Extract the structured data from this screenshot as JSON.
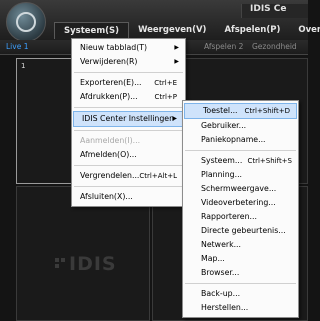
{
  "app": {
    "title": "IDIS Ce"
  },
  "menubar": {
    "items": [
      "Systeem(S)",
      "Weergeven(V)",
      "Afspelen(P)",
      "Over(A)"
    ]
  },
  "tabs": [
    "Live 1",
    "Afspelen 2",
    "Gezondheid"
  ],
  "grid": {
    "cell1_number": "1",
    "watermark": "IDIS"
  },
  "system_menu": {
    "items": [
      {
        "label": "Nieuw tabblad(T)",
        "submenu": true
      },
      {
        "label": "Verwijderen(R)",
        "submenu": true
      },
      {
        "label": "Exporteren(E)...",
        "shortcut": "Ctrl+E"
      },
      {
        "label": "Afdrukken(P)...",
        "shortcut": "Ctrl+P"
      },
      {
        "label": "IDIS Center Instellingen",
        "submenu": true
      },
      {
        "label": "Aanmelden(I)...",
        "disabled": true
      },
      {
        "label": "Afmelden(O)..."
      },
      {
        "label": "Vergrendelen...",
        "shortcut": "Ctrl+Alt+L"
      },
      {
        "label": "Afsluiten(X)..."
      }
    ]
  },
  "settings_submenu": {
    "items": [
      {
        "label": "Toestel...",
        "shortcut": "Ctrl+Shift+D"
      },
      {
        "label": "Gebruiker..."
      },
      {
        "label": "Paniekopname..."
      },
      {
        "label": "Systeem...",
        "shortcut": "Ctrl+Shift+S"
      },
      {
        "label": "Planning..."
      },
      {
        "label": "Schermweergave..."
      },
      {
        "label": "Videoverbetering..."
      },
      {
        "label": "Rapporteren..."
      },
      {
        "label": "Directe gebeurtenis..."
      },
      {
        "label": "Netwerk..."
      },
      {
        "label": "Map..."
      },
      {
        "label": "Browser..."
      },
      {
        "label": "Back-up..."
      },
      {
        "label": "Herstellen..."
      }
    ]
  },
  "colors": {
    "highlight": "#cfe3fb",
    "live_tab": "#3da0ff"
  }
}
